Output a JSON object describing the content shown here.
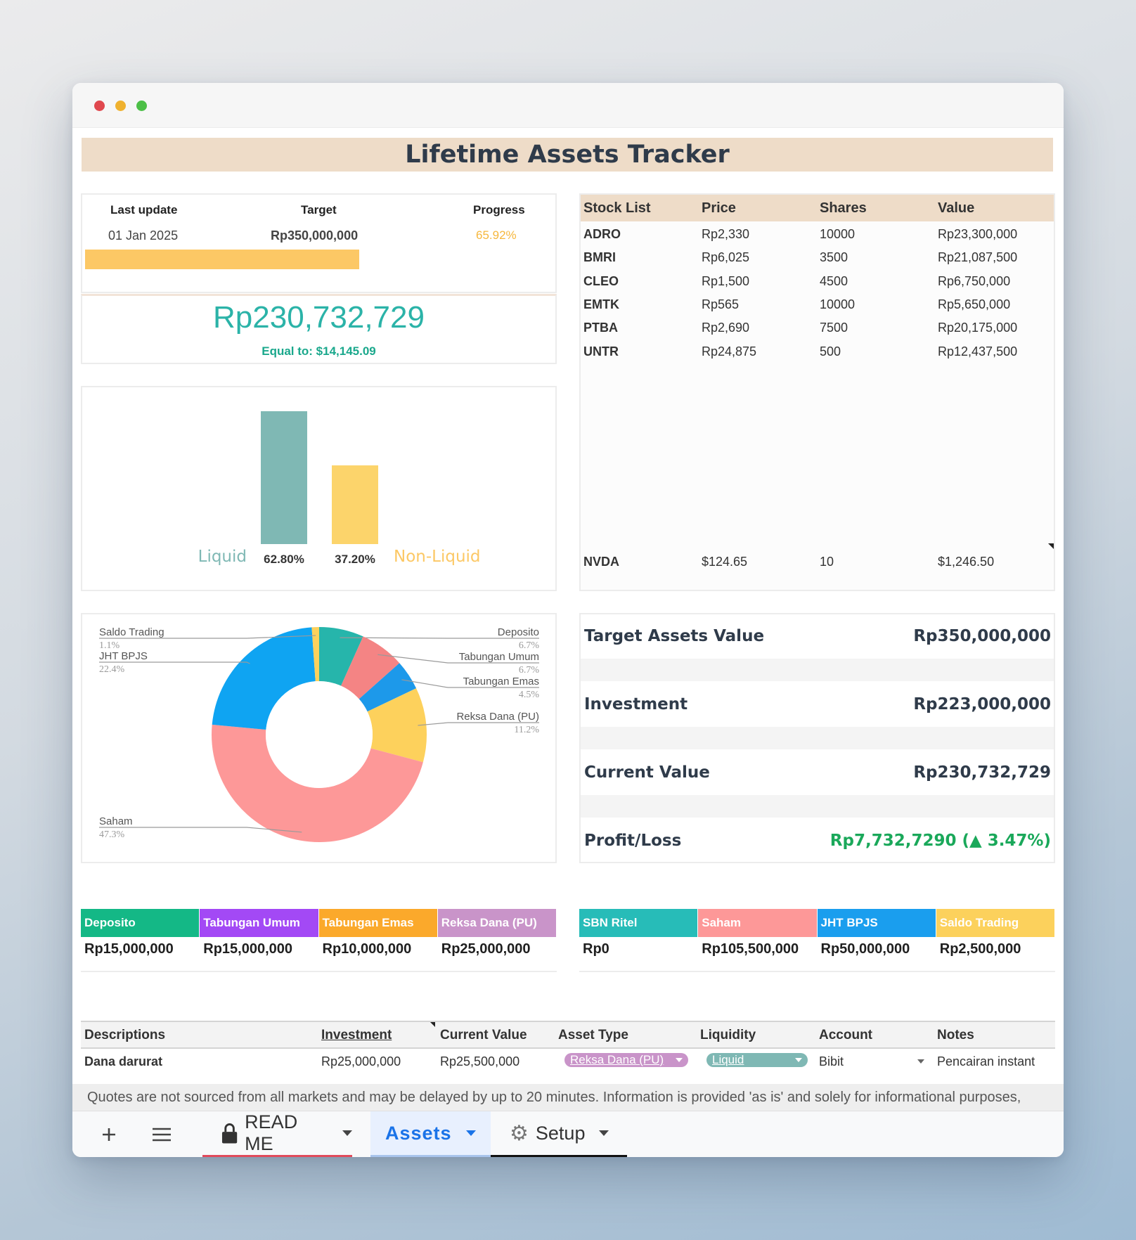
{
  "title": "Lifetime Assets Tracker",
  "progress_card": {
    "headers": {
      "last_update": "Last update",
      "target": "Target",
      "progress": "Progress"
    },
    "last_update": "01 Jan 2025",
    "target": "Rp350,000,000",
    "progress": "65.92%",
    "progress_fraction": 0.6592,
    "total_value": "Rp230,732,729",
    "equal_to": "Equal to: $14,145.09"
  },
  "stock_table": {
    "headers": [
      "Stock List",
      "Price",
      "Shares",
      "Value"
    ],
    "rows": [
      [
        "ADRO",
        "Rp2,330",
        "10000",
        "Rp23,300,000"
      ],
      [
        "BMRI",
        "Rp6,025",
        "3500",
        "Rp21,087,500"
      ],
      [
        "CLEO",
        "Rp1,500",
        "4500",
        "Rp6,750,000"
      ],
      [
        "EMTK",
        "Rp565",
        "10000",
        "Rp5,650,000"
      ],
      [
        "PTBA",
        "Rp2,690",
        "7500",
        "Rp20,175,000"
      ],
      [
        "UNTR",
        "Rp24,875",
        "500",
        "Rp12,437,500"
      ]
    ],
    "foreign_row": [
      "NVDA",
      "$124.65",
      "10",
      "$1,246.50"
    ]
  },
  "chart_data": [
    {
      "type": "bar",
      "categories": [
        "Liquid",
        "Non-Liquid"
      ],
      "values": [
        62.8,
        37.2
      ],
      "data_labels": [
        "62.80%",
        "37.20%"
      ],
      "colors": [
        "#7fb8b4",
        "#fcd46b"
      ],
      "ylim": [
        0,
        62.8
      ]
    },
    {
      "type": "pie",
      "donut": true,
      "slices": [
        {
          "label": "Deposito",
          "pct_label": "6.7%",
          "value": 6.7,
          "color": "#26b5ab"
        },
        {
          "label": "Tabungan Umum",
          "pct_label": "6.7%",
          "value": 6.7,
          "color": "#f48484"
        },
        {
          "label": "Tabungan Emas",
          "pct_label": "4.5%",
          "value": 4.5,
          "color": "#1d99ea"
        },
        {
          "label": "Reksa Dana (PU)",
          "pct_label": "11.2%",
          "value": 11.2,
          "color": "#fdd15c"
        },
        {
          "label": "Saham",
          "pct_label": "47.3%",
          "value": 47.3,
          "color": "#fd9898"
        },
        {
          "label": "JHT BPJS",
          "pct_label": "22.4%",
          "value": 22.4,
          "color": "#0fa4f2"
        },
        {
          "label": "Saldo Trading",
          "pct_label": "1.1%",
          "value": 1.1,
          "color": "#fcd15c"
        }
      ]
    }
  ],
  "summary": {
    "rows": [
      {
        "label": "Target Assets Value",
        "value": "Rp350,000,000"
      },
      {
        "label": "Investment",
        "value": "Rp223,000,000"
      },
      {
        "label": "Current Value",
        "value": "Rp230,732,729"
      },
      {
        "label": "Profit/Loss",
        "value": "Rp7,732,7290 (▲ 3.47%)"
      }
    ],
    "profit_color": "#1aa85a"
  },
  "categories_left": [
    {
      "label": "Deposito",
      "value": "Rp15,000,000",
      "color": "#14b886"
    },
    {
      "label": "Tabungan Umum",
      "value": "Rp15,000,000",
      "color": "#a349f5"
    },
    {
      "label": "Tabungan Emas",
      "value": "Rp10,000,000",
      "color": "#fba92b"
    },
    {
      "label": "Reksa Dana (PU)",
      "value": "Rp25,000,000",
      "color": "#c994c9"
    }
  ],
  "categories_right": [
    {
      "label": "SBN Ritel",
      "value": "Rp0",
      "color": "#27bcb8"
    },
    {
      "label": "Saham",
      "value": "Rp105,500,000",
      "color": "#fd9898"
    },
    {
      "label": "JHT BPJS",
      "value": "Rp50,000,000",
      "color": "#1a9eee"
    },
    {
      "label": "Saldo Trading",
      "value": "Rp2,500,000",
      "color": "#fcd15c"
    }
  ],
  "assets_table": {
    "headers": [
      "Descriptions",
      "Investment",
      "Current Value",
      "Asset Type",
      "Liquidity",
      "Account",
      "Notes"
    ],
    "row": {
      "description": "Dana darurat",
      "investment": "Rp25,000,000",
      "current_value": "Rp25,500,000",
      "asset_type": "Reksa Dana (PU)",
      "liquidity": "Liquid",
      "account": "Bibit",
      "notes": "Pencairan instant"
    }
  },
  "footer_note": "Quotes are not sourced from all markets and may be delayed by up to 20 minutes. Information is provided 'as is' and solely for informational purposes,",
  "sheet_tabs": [
    {
      "label": "READ ME",
      "icon": "lock-icon"
    },
    {
      "label": "Assets",
      "active": true
    },
    {
      "label": "Setup",
      "icon": "gear-icon"
    }
  ],
  "icons": {
    "add": "plus-icon",
    "all_sheets": "menu-icon"
  },
  "colors": {
    "accent_teal": "#2bb3a8",
    "banner_bg": "#eedcc8",
    "progress_bar": "#fcc865",
    "active_tab": "#1a73e8"
  }
}
